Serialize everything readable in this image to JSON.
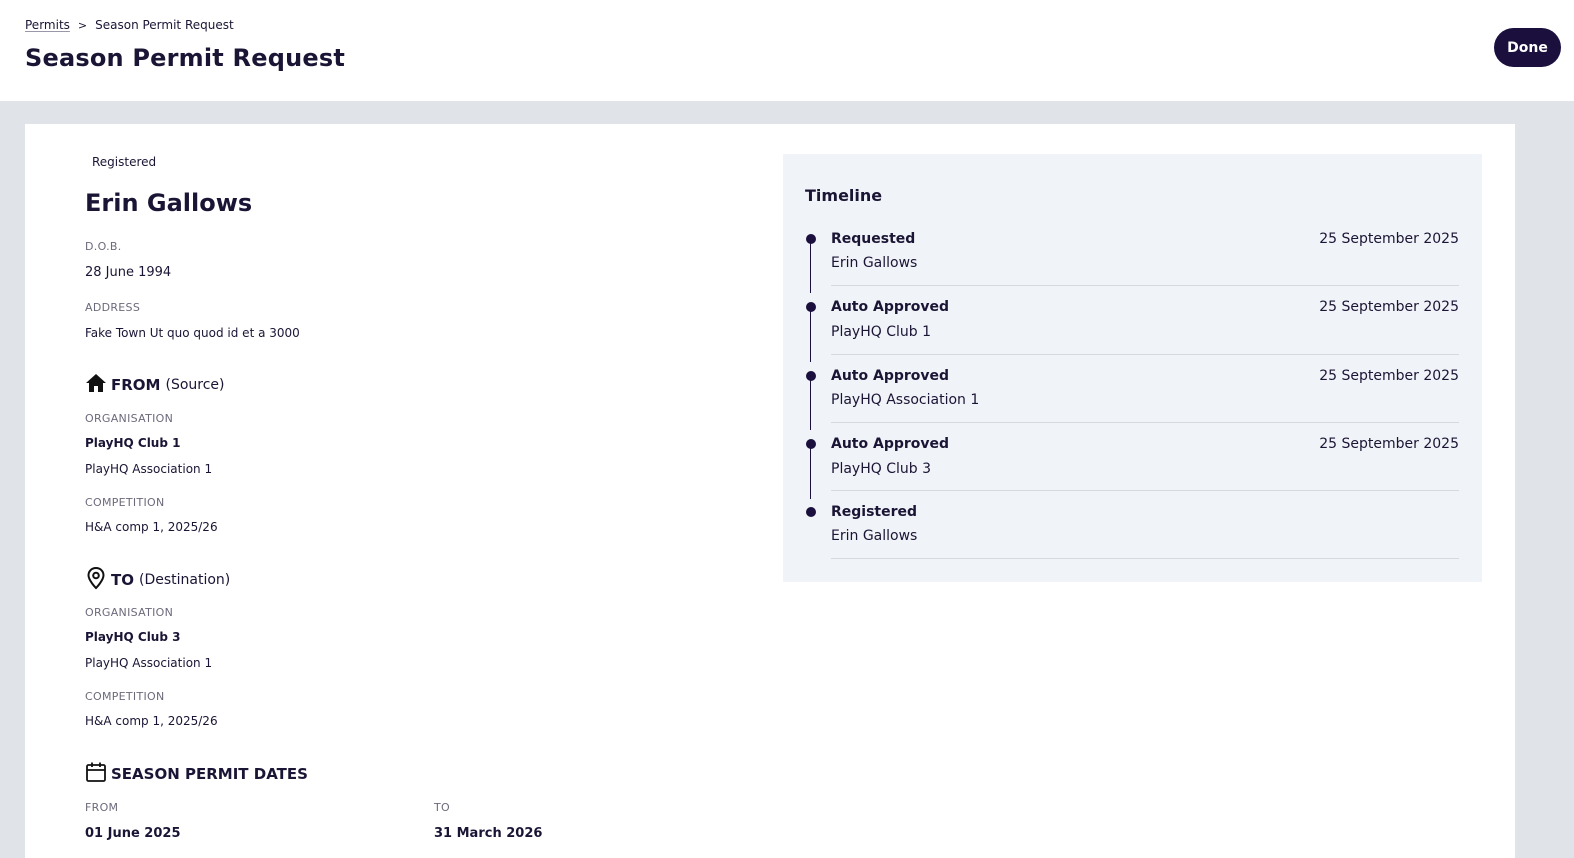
{
  "breadcrumb": {
    "parent": "Permits",
    "separator": ">",
    "current": "Season Permit Request"
  },
  "header": {
    "title": "Season Permit Request",
    "done_label": "Done"
  },
  "person": {
    "status": "Registered",
    "name": "Erin Gallows",
    "dob_label": "D.O.B.",
    "dob": "28 June 1994",
    "address_label": "ADDRESS",
    "address": "Fake Town Ut quo quod id et a 3000"
  },
  "from": {
    "heading": "FROM",
    "subheading": "(Source)",
    "icon": "home-icon",
    "organisation_label": "ORGANISATION",
    "club": "PlayHQ Club 1",
    "association": "PlayHQ Association 1",
    "competition_label": "COMPETITION",
    "competition": "H&A comp 1, 2025/26"
  },
  "to": {
    "heading": "TO",
    "subheading": "(Destination)",
    "icon": "location-pin-icon",
    "organisation_label": "ORGANISATION",
    "club": "PlayHQ Club 3",
    "association": "PlayHQ Association 1",
    "competition_label": "COMPETITION",
    "competition": "H&A comp 1, 2025/26"
  },
  "dates": {
    "heading": "SEASON PERMIT DATES",
    "icon": "calendar-icon",
    "from_label": "FROM",
    "from_value": "01 June 2025",
    "to_label": "TO",
    "to_value": "31 March 2026"
  },
  "timeline": {
    "title": "Timeline",
    "items": [
      {
        "event": "Requested",
        "actor": "Erin Gallows",
        "date": "25 September 2025"
      },
      {
        "event": "Auto Approved",
        "actor": "PlayHQ Club 1",
        "date": "25 September 2025"
      },
      {
        "event": "Auto Approved",
        "actor": "PlayHQ Association 1",
        "date": "25 September 2025"
      },
      {
        "event": "Auto Approved",
        "actor": "PlayHQ Club 3",
        "date": "25 September 2025"
      },
      {
        "event": "Registered",
        "actor": "Erin Gallows",
        "date": ""
      }
    ]
  },
  "colors": {
    "primary": "#1a0f3d",
    "background": "#e0e3e8",
    "panel": "#f0f3f8"
  }
}
